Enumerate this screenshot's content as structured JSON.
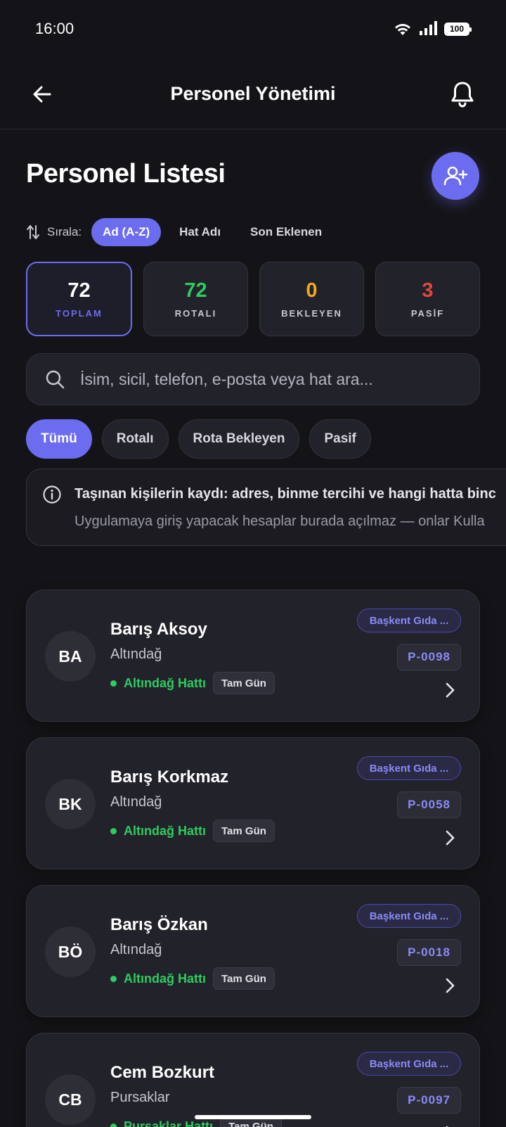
{
  "status": {
    "time": "16:00",
    "battery": "100"
  },
  "app_bar": {
    "title": "Personel Yönetimi"
  },
  "header": {
    "title": "Personel Listesi"
  },
  "sort": {
    "label": "Sırala:",
    "options": [
      "Ad (A-Z)",
      "Hat Adı",
      "Son Eklenen"
    ],
    "selected": "Ad (A-Z)"
  },
  "stats": [
    {
      "value": "72",
      "label": "TOPLAM",
      "color": "#ffffff",
      "label_color": "#6c6cf0"
    },
    {
      "value": "72",
      "label": "ROTALI",
      "color": "#2ecc60",
      "label_color": "#c9c9d2"
    },
    {
      "value": "0",
      "label": "BEKLEYEN",
      "color": "#f5a623",
      "label_color": "#c9c9d2"
    },
    {
      "value": "3",
      "label": "PASİF",
      "color": "#e0483e",
      "label_color": "#c9c9d2"
    }
  ],
  "search": {
    "placeholder": "İsim, sicil, telefon, e-posta veya hat ara..."
  },
  "filters": [
    "Tümü",
    "Rotalı",
    "Rota Bekleyen",
    "Pasif"
  ],
  "info": {
    "title": "Taşınan kişilerin kaydı: adres, binme tercihi ve hangi hatta binc",
    "subtitle": "Uygulamaya giriş yapacak hesaplar burada açılmaz — onlar Kulla"
  },
  "people": [
    {
      "initials": "BA",
      "name": "Barış Aksoy",
      "district": "Altındağ",
      "route": "Altındağ Hattı",
      "shift": "Tam Gün",
      "company": "Başkent Gıda ...",
      "code": "P-0098"
    },
    {
      "initials": "BK",
      "name": "Barış Korkmaz",
      "district": "Altındağ",
      "route": "Altındağ Hattı",
      "shift": "Tam Gün",
      "company": "Başkent Gıda ...",
      "code": "P-0058"
    },
    {
      "initials": "BÖ",
      "name": "Barış Özkan",
      "district": "Altındağ",
      "route": "Altındağ Hattı",
      "shift": "Tam Gün",
      "company": "Başkent Gıda ...",
      "code": "P-0018"
    },
    {
      "initials": "CB",
      "name": "Cem Bozkurt",
      "district": "Pursaklar",
      "route": "Pursaklar Hattı",
      "shift": "Tam Gün",
      "company": "Başkent Gıda ...",
      "code": "P-0097"
    }
  ],
  "icons": {
    "back": "arrow-left-icon",
    "notifications": "bell-icon",
    "add": "user-plus-icon",
    "sort": "sort-arrows-icon",
    "search": "search-icon",
    "info": "info-circle-icon",
    "open": "chevron-right-icon"
  },
  "colors": {
    "accent": "#6c6cf0",
    "success": "#2ecc60",
    "warning": "#f5a623",
    "danger": "#e0483e",
    "background": "#141418",
    "card": "#22222a"
  }
}
